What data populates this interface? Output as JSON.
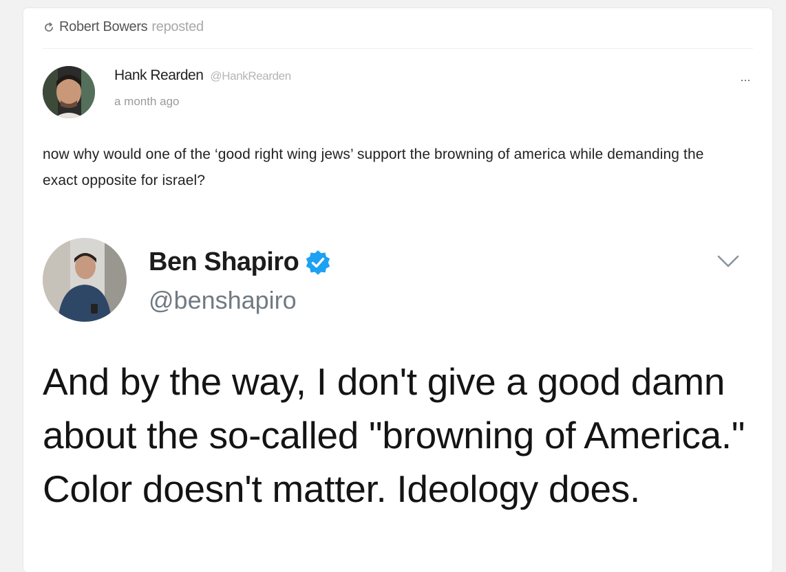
{
  "repost": {
    "user": "Robert Bowers",
    "action": "reposted",
    "icon": "repost-icon"
  },
  "post": {
    "author_name": "Hank Rearden",
    "author_handle": "@HankRearden",
    "timestamp": "a month ago",
    "more_icon": "more-icon",
    "more_label": "···",
    "body": "now why would one of the ‘good right wing jews’ support the browning of america while demanding the exact opposite for israel?"
  },
  "embedded_tweet": {
    "name": "Ben Shapiro",
    "handle": "@benshapiro",
    "verified": true,
    "verified_color": "#1da1f2",
    "text": "And by the way, I don't give a good damn about the so-called \"browning of America.\" Color doesn't matter. Ideology does."
  }
}
